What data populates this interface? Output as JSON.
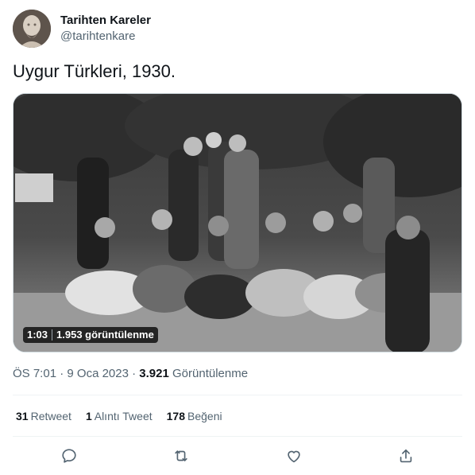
{
  "author": {
    "display_name": "Tarihten Kareler",
    "handle": "@tarihtenkare",
    "avatar_icon": "bust-sculpture-avatar"
  },
  "tweet": {
    "text": "Uygur Türkleri, 1930."
  },
  "video": {
    "duration": "1:03",
    "views_label": "1.953 görüntülenme"
  },
  "meta": {
    "time": "ÖS 7:01",
    "separator": " · ",
    "date": "9 Oca 2023",
    "views_count": "3.921",
    "views_label": "Görüntülenme"
  },
  "stats": {
    "retweets_count": "31",
    "retweets_label": "Retweet",
    "quotes_count": "1",
    "quotes_label": "Alıntı Tweet",
    "likes_count": "178",
    "likes_label": "Beğeni"
  },
  "actions": [
    "reply-icon",
    "retweet-icon",
    "like-icon",
    "share-icon"
  ],
  "colors": {
    "text_primary": "#0f1419",
    "text_secondary": "#536471",
    "action_icon": "#536471",
    "divider": "#eff3f4"
  }
}
